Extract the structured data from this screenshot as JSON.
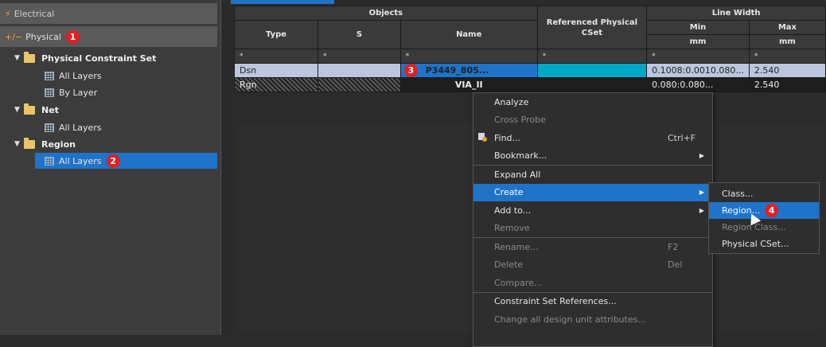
{
  "sidebar": {
    "electrical_label": "Electrical",
    "physical_label": "Physical",
    "badge1": "1",
    "tree": [
      {
        "label": "Physical Constraint Set"
      },
      {
        "label": "All Layers"
      },
      {
        "label": "By Layer"
      },
      {
        "label": "Net"
      },
      {
        "label": "All Layers"
      },
      {
        "label": "Region"
      },
      {
        "label": "All Layers"
      }
    ],
    "badge2": "2"
  },
  "table": {
    "group_objects": "Objects",
    "col_type": "Type",
    "col_s": "S",
    "col_name": "Name",
    "col_ref": "Referenced Physical CSet",
    "group_linewidth": "Line Width",
    "col_min": "Min",
    "col_max": "Max",
    "unit_min": "mm",
    "unit_max": "mm",
    "filter": "*",
    "rows": [
      {
        "type": "Dsn",
        "name": "P3449_805...",
        "min": "0.1008:0.0010.080...",
        "max": "2.540"
      },
      {
        "type": "Rgn",
        "name": "VIA_II",
        "min": "0.080:0.080...",
        "max": "2.540"
      }
    ],
    "badge3": "3"
  },
  "context_menu": {
    "items": [
      {
        "label": "Analyze"
      },
      {
        "label": "Cross Probe"
      },
      {
        "label": "Find...",
        "shortcut": "Ctrl+F"
      },
      {
        "label": "Bookmark..."
      },
      {
        "label": "Expand All"
      },
      {
        "label": "Create"
      },
      {
        "label": "Add to..."
      },
      {
        "label": "Remove"
      },
      {
        "label": "Rename...",
        "shortcut": "F2"
      },
      {
        "label": "Delete",
        "shortcut": "Del"
      },
      {
        "label": "Compare..."
      },
      {
        "label": "Constraint Set References..."
      },
      {
        "label": "Change all design unit attributes..."
      }
    ],
    "submenu_arrow": "▶"
  },
  "submenu": {
    "items": [
      {
        "label": "Class..."
      },
      {
        "label": "Region..."
      },
      {
        "label": "Region Class..."
      },
      {
        "label": "Physical CSet..."
      }
    ],
    "badge4": "4"
  },
  "colors": {
    "accent": "#1f73c9",
    "badge": "#e02020",
    "folder": "#e8c56a"
  }
}
